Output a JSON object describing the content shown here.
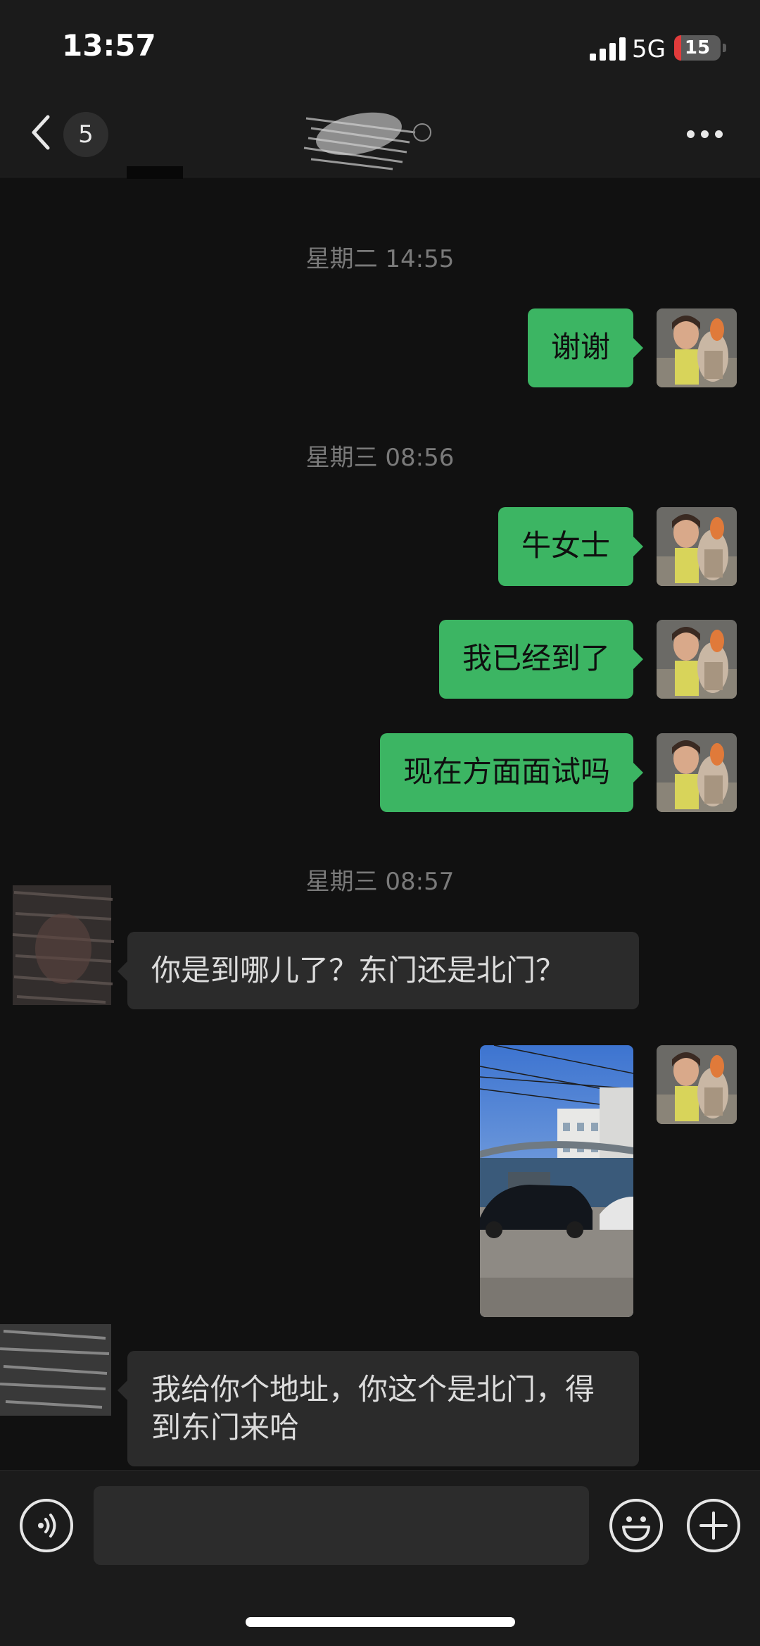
{
  "status_bar": {
    "time": "13:57",
    "network": "5G",
    "battery_level": "15",
    "battery_fraction": 0.15,
    "battery_color": "#e23b3b"
  },
  "header": {
    "unread_count": "5",
    "back_icon": "chevron-left-icon",
    "more_icon": "more-dots-icon"
  },
  "messages": [
    {
      "kind": "time",
      "text": "星期二 14:55"
    },
    {
      "kind": "mine",
      "text": "谢谢"
    },
    {
      "kind": "time",
      "text": "星期三 08:56"
    },
    {
      "kind": "mine",
      "text": "牛女士"
    },
    {
      "kind": "mine",
      "text": "我已经到了"
    },
    {
      "kind": "mine",
      "text": "现在方面面试吗"
    },
    {
      "kind": "time",
      "text": "星期三 08:57"
    },
    {
      "kind": "theirs",
      "text": "你是到哪儿了？东门还是北门？"
    },
    {
      "kind": "mine_image",
      "text": ""
    },
    {
      "kind": "theirs",
      "text": "我给你个地址，你这个是北门，得到东门来哈"
    }
  ],
  "input_bar": {
    "voice_icon": "voice-icon",
    "emoji_icon": "emoji-icon",
    "plus_icon": "plus-icon"
  },
  "colors": {
    "background": "#111111",
    "bar": "#1b1b1b",
    "my_bubble": "#3cb563",
    "their_bubble": "#2b2b2b",
    "timestamp": "#7a7a7a"
  }
}
